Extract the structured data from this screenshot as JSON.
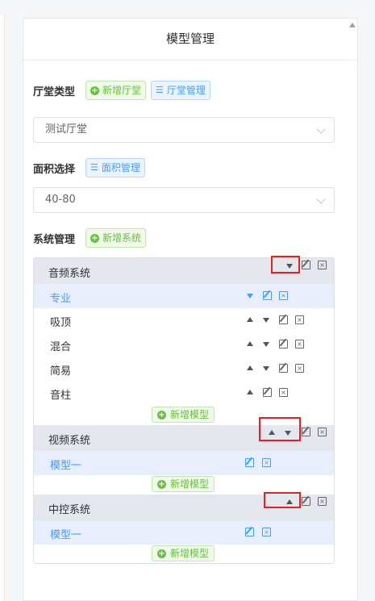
{
  "panel": {
    "title": "模型管理"
  },
  "hall": {
    "label": "厅堂类型",
    "add_label": "新增厅堂",
    "manage_label": "厅堂管理",
    "selected": "测试厅堂"
  },
  "area": {
    "label": "面积选择",
    "manage_label": "面积管理",
    "selected": "40-80"
  },
  "system": {
    "label": "系统管理",
    "add_label": "新增系统"
  },
  "groups": [
    {
      "name": "音频系统",
      "items": [
        "专业",
        "吸顶",
        "混合",
        "简易",
        "音柱"
      ],
      "add_label": "新增模型"
    },
    {
      "name": "视频系统",
      "items": [
        "模型一"
      ],
      "add_label": "新增模型"
    },
    {
      "name": "中控系统",
      "items": [
        "模型一"
      ],
      "add_label": "新增模型"
    }
  ],
  "colors": {
    "accent": "#409eff",
    "success": "#67c23a",
    "highlight": "#e52020"
  }
}
